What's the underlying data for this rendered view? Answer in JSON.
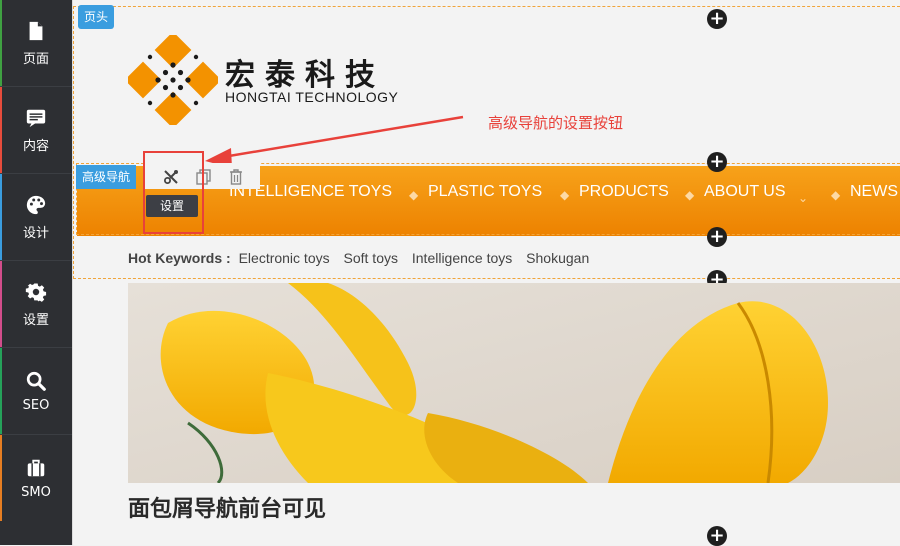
{
  "sidebar": {
    "items": [
      {
        "label": "页面",
        "icon": "file-icon",
        "accent": "#3fa142"
      },
      {
        "label": "内容",
        "icon": "content-icon",
        "accent": "#e74c3c"
      },
      {
        "label": "设计",
        "icon": "palette-icon",
        "accent": "#3a9ddf"
      },
      {
        "label": "设置",
        "icon": "gear-icon",
        "accent": "#d24d8b"
      },
      {
        "label": "SEO",
        "icon": "search-icon",
        "accent": "#25a25a"
      },
      {
        "label": "SMO",
        "icon": "briefcase-icon",
        "accent": "#e67e22"
      }
    ]
  },
  "header": {
    "tag_label": "页头",
    "brand_cn": "宏泰科技",
    "brand_en": "HONGTAI TECHNOLOGY"
  },
  "annotation": {
    "text": "高级导航的设置按钮",
    "color": "#e8413a"
  },
  "nav": {
    "tag_label": "高级导航",
    "tooltip": "设置",
    "items": [
      "INTELLIGENCE TOYS",
      "PLASTIC TOYS",
      "PRODUCTS",
      "ABOUT US",
      "NEWS"
    ],
    "toolbar": {
      "settings_icon": "wrench-screwdriver-icon",
      "copy_icon": "copy-icon",
      "delete_icon": "trash-icon"
    }
  },
  "keywords": {
    "label": "Hot Keywords :",
    "items": [
      "Electronic toys",
      "Soft toys",
      "Intelligence toys",
      "Shokugan"
    ]
  },
  "breadcrumb_note": "面包屑导航前台可见",
  "add_glyph": "+",
  "colors": {
    "nav_orange": "#f39200",
    "tag_blue": "#3a9ddf",
    "dash_orange": "#f0a43a",
    "sidebar_bg": "#2d2f33"
  }
}
